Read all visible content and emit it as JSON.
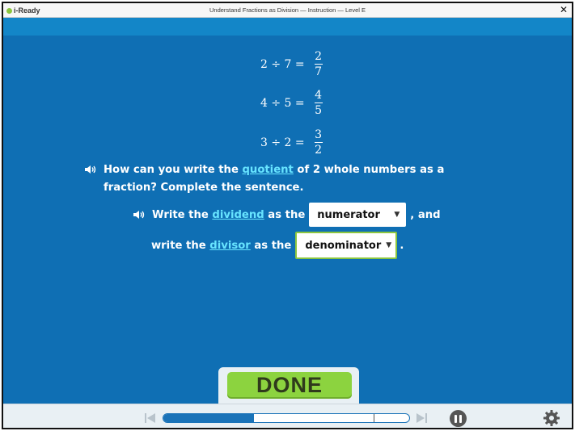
{
  "window": {
    "app_name": "i-Ready",
    "title": "Understand Fractions as Division — Instruction — Level E",
    "close_glyph": "✕"
  },
  "equations": [
    {
      "lhs": "2 ÷ 7 =",
      "numerator": "2",
      "denominator": "7"
    },
    {
      "lhs": "4 ÷ 5 =",
      "numerator": "4",
      "denominator": "5"
    },
    {
      "lhs": "3 ÷ 2 =",
      "numerator": "3",
      "denominator": "2"
    }
  ],
  "question": {
    "part1": "How can you write the ",
    "vocab": "quotient",
    "part2": " of 2 whole numbers as a fraction? Complete the sentence."
  },
  "sentence": {
    "line1_a": "Write the ",
    "line1_vocab": "dividend",
    "line1_b": " as the",
    "dropdown1_value": "numerator",
    "line1_c": ", and",
    "line2_a": "write the ",
    "line2_vocab": "divisor",
    "line2_b": " as the",
    "dropdown2_value": "denominator",
    "line2_c": "."
  },
  "done_label": "DONE",
  "progress_fraction": 0.37,
  "icons": {
    "speaker": "speaker-icon",
    "caret": "▼",
    "prev": "skip-back-icon",
    "next": "skip-forward-icon",
    "pause": "pause-icon",
    "settings": "gear-icon"
  },
  "colors": {
    "stage": "#0f6fb4",
    "vocab": "#67e4ff",
    "done_green": "#8cd33f",
    "progress_blue": "#1a73b8"
  }
}
